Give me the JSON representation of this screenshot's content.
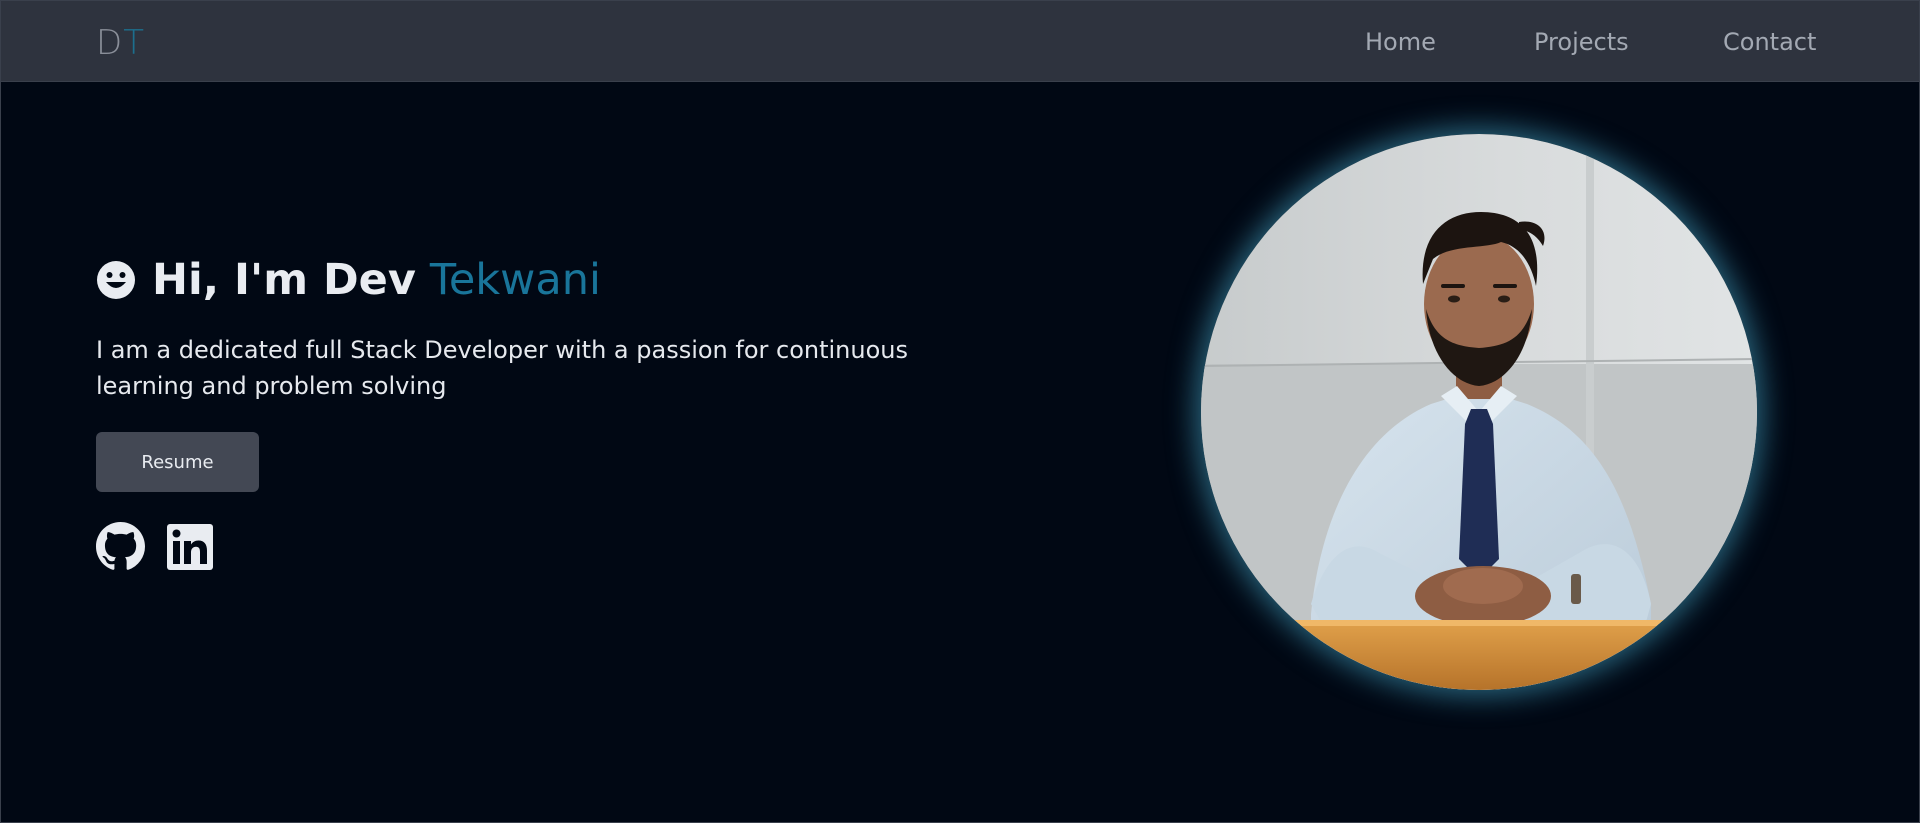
{
  "navbar": {
    "logo": {
      "first": "D",
      "second": "T"
    },
    "links": [
      {
        "label": "Home"
      },
      {
        "label": "Projects"
      },
      {
        "label": "Contact"
      }
    ]
  },
  "hero": {
    "greeting": {
      "emoji_icon": "smiley-face-icon",
      "prefix": "Hi, I'm Dev",
      "highlight": "Tekwani"
    },
    "bio": "I am a dedicated full Stack Developer with a passion for continuous learning and problem solving",
    "resume_button": "Resume",
    "social": [
      {
        "icon": "github-icon"
      },
      {
        "icon": "linkedin-icon"
      }
    ],
    "portrait_icon": "profile-photo"
  },
  "colors": {
    "background": "#010814",
    "navbar": "#2e333e",
    "accent": "#19759a",
    "button": "#434854",
    "glow": "#4ab2d6"
  }
}
